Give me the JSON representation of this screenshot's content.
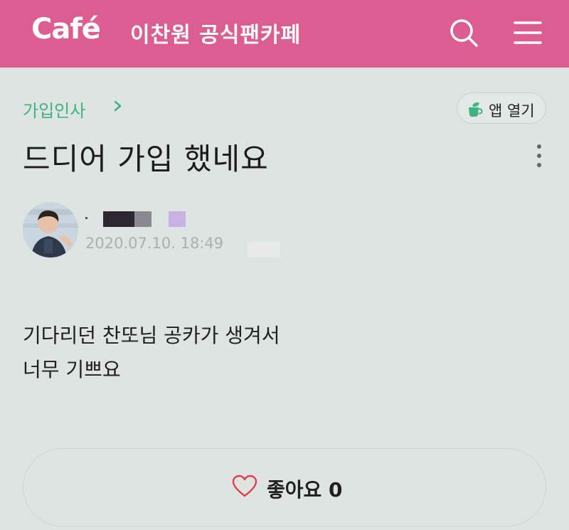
{
  "header": {
    "logo": "Café",
    "cafe_name": "이찬원 공식팬카페",
    "icons": [
      "search-icon",
      "menu-icon"
    ],
    "background_color": "#dc5d8f"
  },
  "post": {
    "breadcrumb": "가입인사",
    "open_app_label": "앱 열기",
    "title": "드디어 가입 했네요",
    "date": "2020.07.10. 18:49",
    "body": [
      "기다리던 찬또님 공카가 생겨서",
      "너무 기쁘요"
    ],
    "like_label": "좋아요 0"
  },
  "colors": {
    "accent_green": "#3fb380",
    "heart": "#e0404b",
    "background": "#dde4e2"
  }
}
